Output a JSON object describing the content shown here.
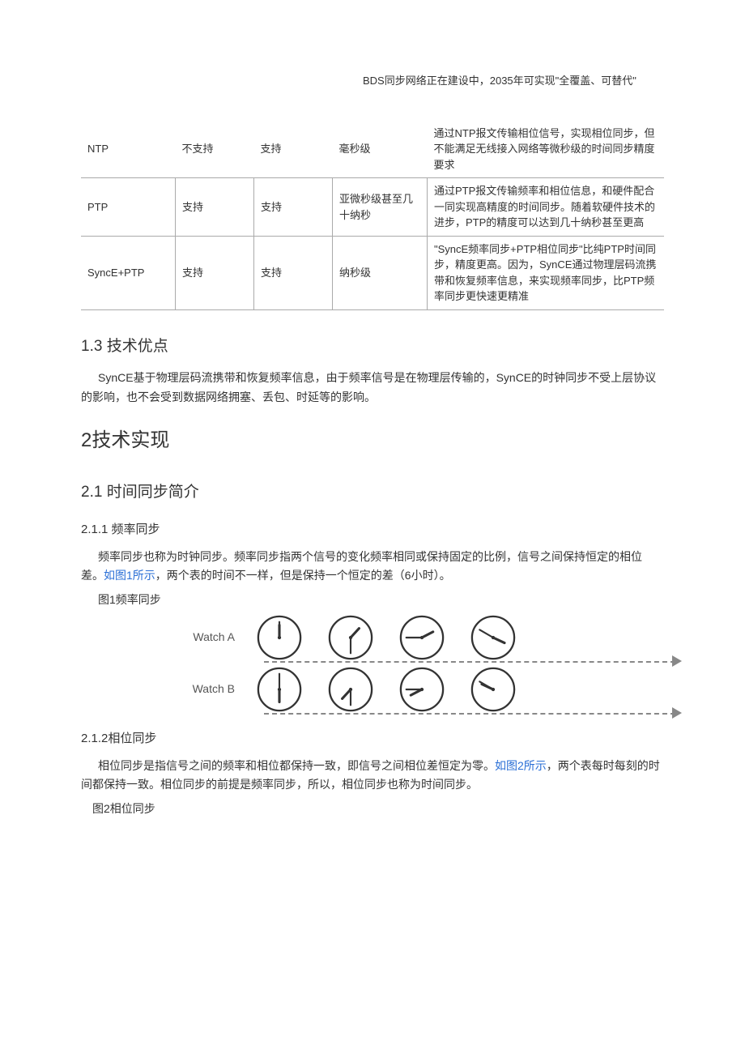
{
  "top_note": "BDS同步网络正在建设中，2035年可实现\"全覆盖、可替代\"",
  "table": {
    "rows": [
      {
        "name": "NTP",
        "col_a": "不支持",
        "col_b": "支持",
        "col_c": "毫秒级",
        "desc": "通过NTP报文传输相位信号，实现相位同步，但不能满足无线接入网络等微秒级的时间同步精度要求"
      },
      {
        "name": "PTP",
        "col_a": "支持",
        "col_b": "支持",
        "col_c": "亚微秒级甚至几十纳秒",
        "desc": "通过PTP报文传输频率和相位信息，和硬件配合一同实现高精度的时间同步。随着软硬件技术的进步，PTP的精度可以达到几十纳秒甚至更高"
      },
      {
        "name": "SyncE+PTP",
        "col_a": "支持",
        "col_b": "支持",
        "col_c": "纳秒级",
        "desc": "\"SyncE频率同步+PTP相位同步\"比纯PTP时间同步，精度更高。因为，SynCE通过物理层码流携带和恢复频率信息，来实现频率同步，比PTP频率同步更快速更精准"
      }
    ]
  },
  "sec_1_3": {
    "heading": "1.3  技术优点",
    "para": "SynCE基于物理层码流携带和恢复频率信息，由于频率信号是在物理层传输的，SynCE的时钟同步不受上层协议的影响，也不会受到数据网络拥塞、丢包、时延等的影响。"
  },
  "sec_2": {
    "heading": "2技术实现"
  },
  "sec_2_1": {
    "heading": "2.1  时间同步简介"
  },
  "sec_2_1_1": {
    "heading": "2.1.1  频率同步",
    "para_part1": "频率同步也称为时钟同步。频率同步指两个信号的变化频率相同或保持固定的比例，信号之间保持恒定的相位差。",
    "link": "如图1所示",
    "para_part2": "，两个表的时间不一样，但是保持一个恒定的差（6小时）。",
    "caption": "图1频率同步",
    "watch_a_label": "Watch A",
    "watch_b_label": "Watch B",
    "chart_data": {
      "type": "table",
      "title": "图1 频率同步 — 两个表保持6小时恒定相位差",
      "series": [
        {
          "name": "Watch A",
          "values": [
            "12:00",
            "1:25",
            "2:05",
            "3:50"
          ]
        },
        {
          "name": "Watch B",
          "values": [
            "6:00",
            "7:25",
            "8:05",
            "9:50"
          ]
        }
      ]
    },
    "clocks_a": [
      [
        0,
        0
      ],
      [
        42.5,
        180
      ],
      [
        62.5,
        270
      ],
      [
        115,
        300
      ]
    ],
    "clocks_b": [
      [
        180,
        0
      ],
      [
        222.5,
        180
      ],
      [
        242.5,
        270
      ],
      [
        295,
        300
      ]
    ]
  },
  "sec_2_1_2": {
    "heading": "2.1.2相位同步",
    "para_part1": "相位同步是指信号之间的频率和相位都保持一致，即信号之间相位差恒定为零。",
    "link": "如图2所示",
    "para_part2": "，两个表每时每刻的时间都保持一致。相位同步的前提是频率同步，所以，相位同步也称为时间同步。",
    "caption": "图2相位同步"
  }
}
